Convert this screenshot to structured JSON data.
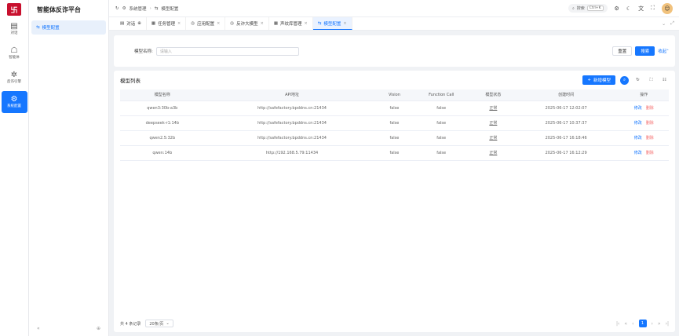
{
  "app": {
    "logo": "卐",
    "title": "智能体反诈平台"
  },
  "rail": [
    {
      "icon": "▤",
      "label": "对话"
    },
    {
      "icon": "☖",
      "label": "智能体"
    },
    {
      "icon": "✲",
      "label": "反诈引擎"
    },
    {
      "icon": "⚙",
      "label": "系统配置"
    }
  ],
  "sidebar": {
    "item": "模型配置",
    "collapse": "«",
    "pin": "⊕"
  },
  "header": {
    "breadcrumb": [
      "系统管理",
      "模型配置"
    ],
    "search": "搜索",
    "shortcut": "Ctrl+K"
  },
  "tabs": [
    {
      "label": "对话"
    },
    {
      "label": "任务管理"
    },
    {
      "label": "应用配置"
    },
    {
      "label": "反诈大模型"
    },
    {
      "label": "声纹库管理"
    },
    {
      "label": "模型配置"
    }
  ],
  "filter": {
    "label": "模型名称:",
    "placeholder": "请输入",
    "reset": "重置",
    "search": "搜索",
    "collapse": "收起"
  },
  "table": {
    "title": "模型列表",
    "add": "新增模型",
    "columns": [
      "模型名称",
      "API地址",
      "Vision",
      "Function Call",
      "模型状态",
      "创建时间",
      "操作"
    ],
    "rows": [
      [
        "qwen3:30b-a3b",
        "http://safefactory.bpddns.cn:21434",
        "false",
        "false",
        "正常",
        "2025-06-17 12:02:07"
      ],
      [
        "deepseek-r1:14b",
        "http://safefactory.bpddns.cn:21434",
        "false",
        "false",
        "正常",
        "2025-06-17 10:37:37"
      ],
      [
        "qwen2.5:32b",
        "http://safefactory.bpddns.cn:21434",
        "false",
        "false",
        "正常",
        "2025-06-17 16:18:46"
      ],
      [
        "qwen:14b",
        "http://192.168.5.79:11434",
        "false",
        "false",
        "正常",
        "2025-06-17 16:12:29"
      ]
    ],
    "edit": "修改",
    "delete": "删除",
    "total": "共 4 条记录",
    "page_size": "20条/页",
    "current_page": "1"
  }
}
